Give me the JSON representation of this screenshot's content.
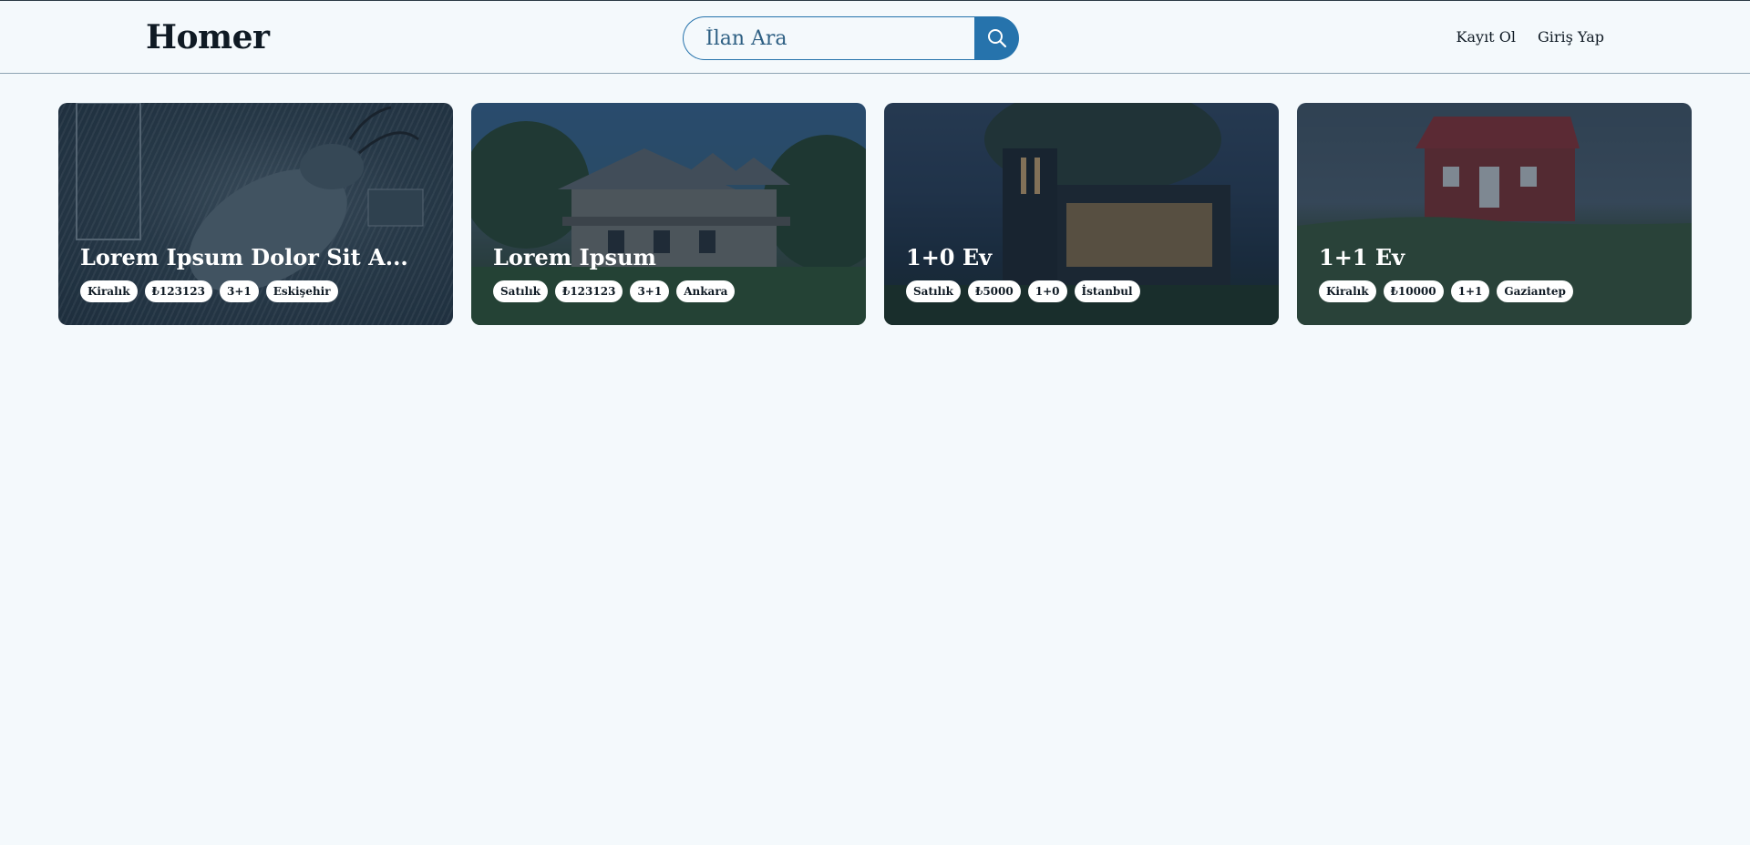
{
  "header": {
    "logo": "Homer",
    "search_placeholder": "İlan Ara",
    "register_label": "Kayıt Ol",
    "login_label": "Giriş Yap"
  },
  "colors": {
    "accent": "#2673ac",
    "background": "#f4f9fc",
    "text": "#0f1a24"
  },
  "listings": [
    {
      "title": "Lorem Ipsum Dolor Sit A...",
      "tags": [
        "Kiralık",
        "₺123123",
        "3+1",
        "Eskişehir"
      ]
    },
    {
      "title": "Lorem Ipsum",
      "tags": [
        "Satılık",
        "₺123123",
        "3+1",
        "Ankara"
      ]
    },
    {
      "title": "1+0 Ev",
      "tags": [
        "Satılık",
        "₺5000",
        "1+0",
        "İstanbul"
      ]
    },
    {
      "title": "1+1 Ev",
      "tags": [
        "Kiralık",
        "₺10000",
        "1+1",
        "Gaziantep"
      ]
    }
  ]
}
